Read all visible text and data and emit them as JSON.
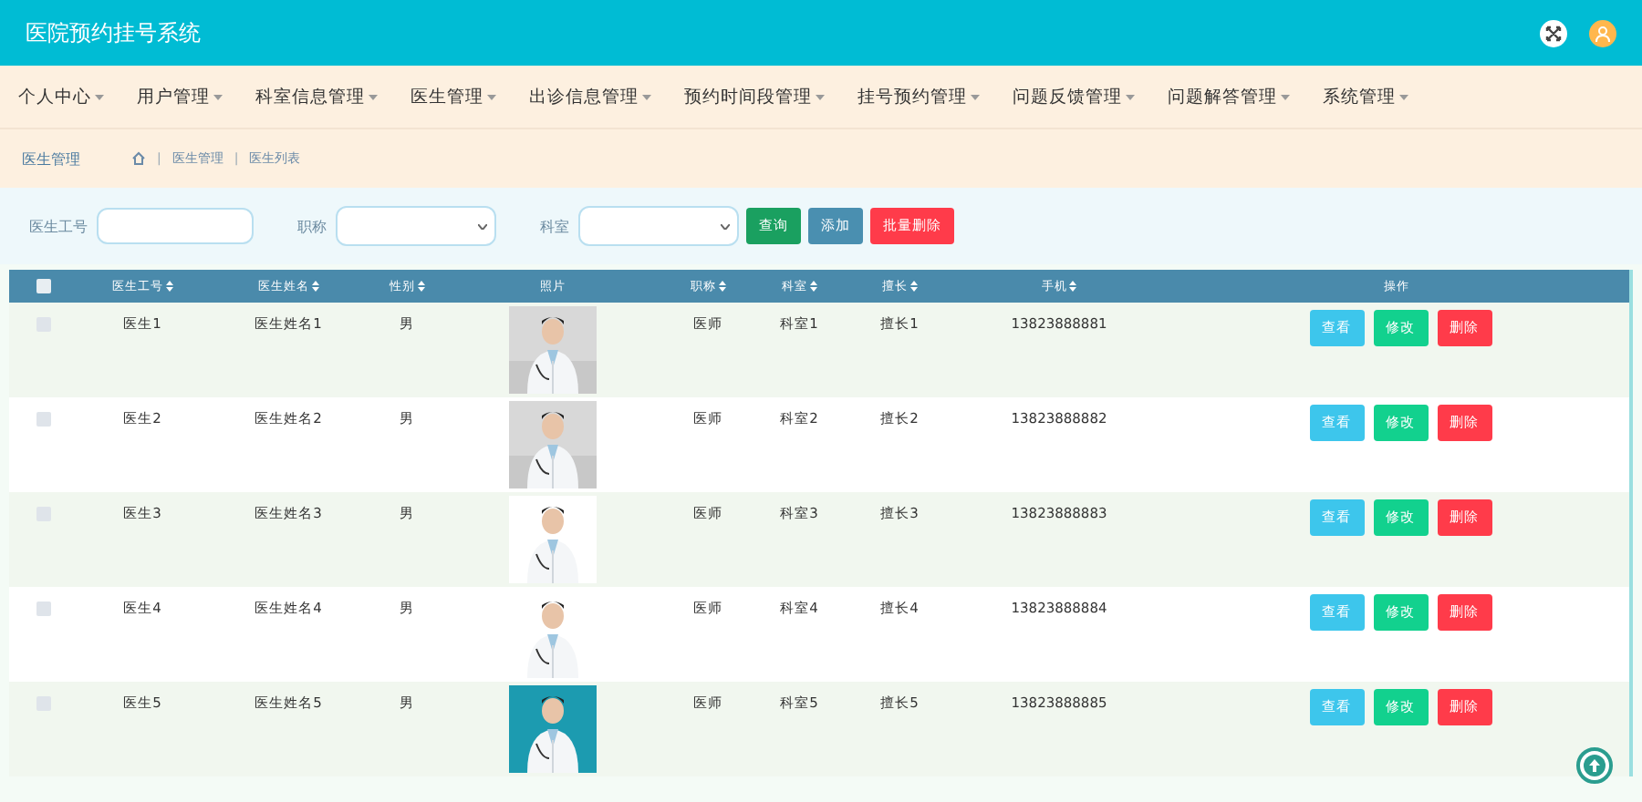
{
  "header": {
    "title": "医院预约挂号系统"
  },
  "nav": [
    {
      "label": "个人中心"
    },
    {
      "label": "用户管理"
    },
    {
      "label": "科室信息管理"
    },
    {
      "label": "医生管理"
    },
    {
      "label": "出诊信息管理"
    },
    {
      "label": "预约时间段管理"
    },
    {
      "label": "挂号预约管理"
    },
    {
      "label": "问题反馈管理"
    },
    {
      "label": "问题解答管理"
    },
    {
      "label": "系统管理"
    }
  ],
  "breadcrumb": {
    "title": "医生管理",
    "items": [
      {
        "kind": "separator",
        "text": "|"
      },
      {
        "kind": "link",
        "text": "医生管理"
      },
      {
        "kind": "separator",
        "text": "|"
      },
      {
        "kind": "link",
        "text": "医生列表"
      }
    ]
  },
  "search": {
    "fields": [
      {
        "label": "医生工号",
        "kind": "text"
      },
      {
        "label": "职称",
        "kind": "select"
      },
      {
        "label": "科室",
        "kind": "select"
      }
    ],
    "buttons": [
      {
        "label": "查询",
        "kind": "search"
      },
      {
        "label": "添加",
        "kind": "add"
      },
      {
        "label": "批量删除",
        "kind": "delete"
      }
    ]
  },
  "table": {
    "select_all_checked": false,
    "columns": [
      {
        "label": "医生工号",
        "sortable": true
      },
      {
        "label": "医生姓名",
        "sortable": true
      },
      {
        "label": "性别",
        "sortable": true
      },
      {
        "label": "照片",
        "sortable": false
      },
      {
        "label": "职称",
        "sortable": true
      },
      {
        "label": "科室",
        "sortable": true
      },
      {
        "label": "擅长",
        "sortable": true
      },
      {
        "label": "手机",
        "sortable": true
      },
      {
        "label": "操作",
        "sortable": false
      }
    ],
    "rows": [
      {
        "checked": false,
        "cells": [
          {
            "kind": "text",
            "text": "医生1"
          },
          {
            "kind": "text",
            "text": "医生姓名1"
          },
          {
            "kind": "text",
            "text": "男"
          },
          {
            "kind": "picture"
          },
          {
            "kind": "text",
            "text": "医师"
          },
          {
            "kind": "text",
            "text": "科室1"
          },
          {
            "kind": "text",
            "text": "擅长1"
          },
          {
            "kind": "text",
            "text": "13823888881"
          }
        ],
        "actions": [
          {
            "label": "查看",
            "kind": "view"
          },
          {
            "label": "修改",
            "kind": "edit"
          },
          {
            "label": "删除",
            "kind": "delete"
          }
        ]
      },
      {
        "checked": false,
        "cells": [
          {
            "kind": "text",
            "text": "医生2"
          },
          {
            "kind": "text",
            "text": "医生姓名2"
          },
          {
            "kind": "text",
            "text": "男"
          },
          {
            "kind": "picture"
          },
          {
            "kind": "text",
            "text": "医师"
          },
          {
            "kind": "text",
            "text": "科室2"
          },
          {
            "kind": "text",
            "text": "擅长2"
          },
          {
            "kind": "text",
            "text": "13823888882"
          }
        ],
        "actions": [
          {
            "label": "查看",
            "kind": "view"
          },
          {
            "label": "修改",
            "kind": "edit"
          },
          {
            "label": "删除",
            "kind": "delete"
          }
        ]
      },
      {
        "checked": false,
        "cells": [
          {
            "kind": "text",
            "text": "医生3"
          },
          {
            "kind": "text",
            "text": "医生姓名3"
          },
          {
            "kind": "text",
            "text": "男"
          },
          {
            "kind": "picture"
          },
          {
            "kind": "text",
            "text": "医师"
          },
          {
            "kind": "text",
            "text": "科室3"
          },
          {
            "kind": "text",
            "text": "擅长3"
          },
          {
            "kind": "text",
            "text": "13823888883"
          }
        ],
        "actions": [
          {
            "label": "查看",
            "kind": "view"
          },
          {
            "label": "修改",
            "kind": "edit"
          },
          {
            "label": "删除",
            "kind": "delete"
          }
        ]
      },
      {
        "checked": false,
        "cells": [
          {
            "kind": "text",
            "text": "医生4"
          },
          {
            "kind": "text",
            "text": "医生姓名4"
          },
          {
            "kind": "text",
            "text": "男"
          },
          {
            "kind": "picture"
          },
          {
            "kind": "text",
            "text": "医师"
          },
          {
            "kind": "text",
            "text": "科室4"
          },
          {
            "kind": "text",
            "text": "擅长4"
          },
          {
            "kind": "text",
            "text": "13823888884"
          }
        ],
        "actions": [
          {
            "label": "查看",
            "kind": "view"
          },
          {
            "label": "修改",
            "kind": "edit"
          },
          {
            "label": "删除",
            "kind": "delete"
          }
        ]
      },
      {
        "checked": false,
        "cells": [
          {
            "kind": "text",
            "text": "医生5"
          },
          {
            "kind": "text",
            "text": "医生姓名5"
          },
          {
            "kind": "text",
            "text": "男"
          },
          {
            "kind": "picture"
          },
          {
            "kind": "text",
            "text": "医师"
          },
          {
            "kind": "text",
            "text": "科室5"
          },
          {
            "kind": "text",
            "text": "擅长5"
          },
          {
            "kind": "text",
            "text": "13823888885"
          }
        ],
        "actions": [
          {
            "label": "查看",
            "kind": "view"
          },
          {
            "label": "修改",
            "kind": "edit"
          },
          {
            "label": "删除",
            "kind": "delete"
          }
        ]
      }
    ]
  }
}
